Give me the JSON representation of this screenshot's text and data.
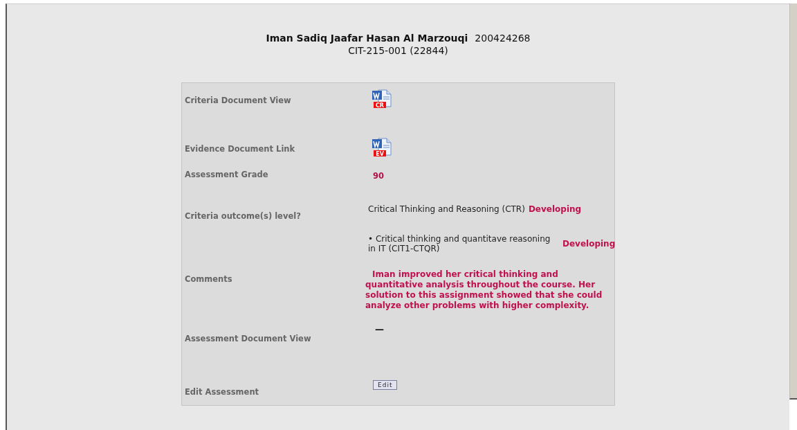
{
  "header": {
    "name": "Iman Sadiq Jaafar Hasan Al Marzouqi",
    "id": "200424268",
    "course": "CIT-215-001 (22844)"
  },
  "rows": [
    {
      "kind": "document",
      "label": "Criteria Document View",
      "badge": "CR"
    },
    {
      "kind": "document",
      "label": "Evidence Document Link",
      "badge": "EV"
    },
    {
      "kind": "grade",
      "label": "Assessment Grade",
      "value": "90"
    },
    {
      "kind": "outcome",
      "label": "Criteria outcome(s) level?",
      "text": "Critical Thinking and Reasoning (CTR)",
      "level": "Developing"
    },
    {
      "kind": "suboutcome",
      "text": "• Critical thinking and quantitave reasoning in IT (CIT1-CTQR)",
      "level": "Developing"
    },
    {
      "kind": "comments",
      "label": "Comments",
      "value": "Iman improved her critical thinking and quantitative analysis throughout the course. Her solution to this assignment showed that she could analyze other problems with higher complexity."
    },
    {
      "kind": "dash",
      "label": "Assessment Document View",
      "value": "—"
    },
    {
      "kind": "button",
      "label": "Edit Assessment",
      "value": "Edit"
    }
  ]
}
